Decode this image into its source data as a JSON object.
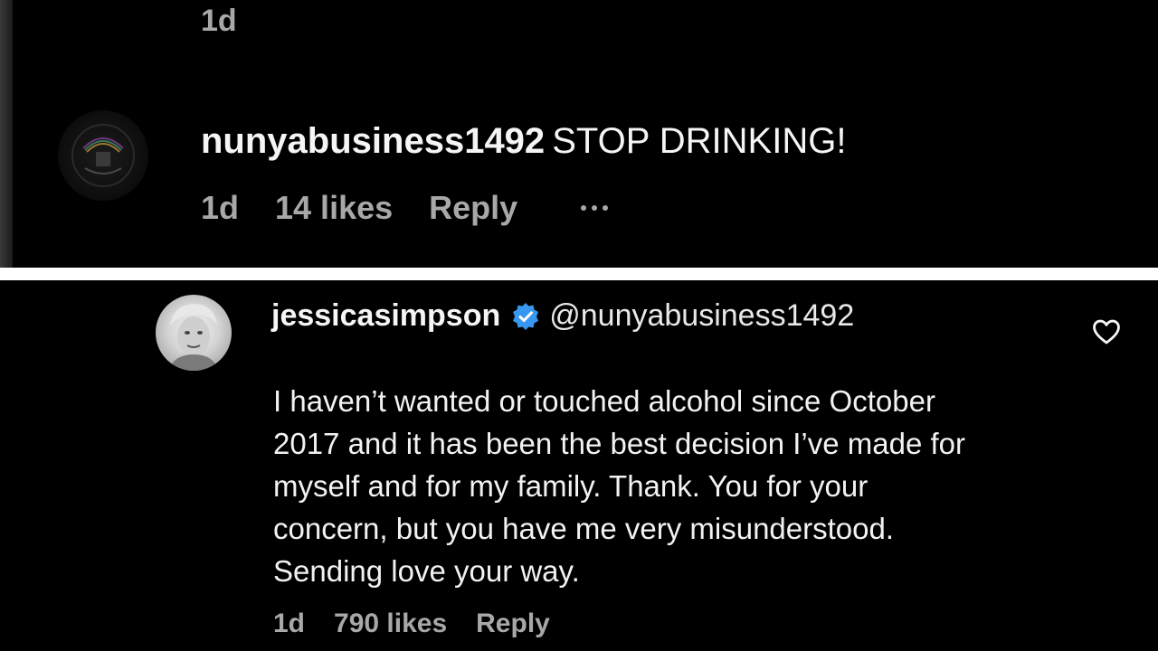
{
  "top_comment_previous": {
    "timestamp": "1d"
  },
  "comment": {
    "username": "nunyabusiness1492",
    "text": "STOP DRINKING!",
    "timestamp": "1d",
    "likes": "14 likes",
    "reply_label": "Reply",
    "more_icon": "ellipsis-icon"
  },
  "reply": {
    "username": "jessicasimpson",
    "verified_icon": "verified-badge-icon",
    "verified_color": "#3897f0",
    "mention": "@nunyabusiness1492",
    "lines": [
      "I haven’t wanted or touched alcohol since October",
      "2017 and it has been the best decision I’ve made for",
      "myself and for my family. Thank. You for your",
      "concern, but you have me very misunderstood.",
      "Sending love your way."
    ],
    "timestamp": "1d",
    "likes": "790 likes",
    "reply_label": "Reply",
    "like_icon": "heart-outline-icon"
  },
  "colors": {
    "background": "#000000",
    "divider": "#ffffff",
    "primary_text": "#f5f5f5",
    "secondary_text": "#a8a8a8"
  }
}
